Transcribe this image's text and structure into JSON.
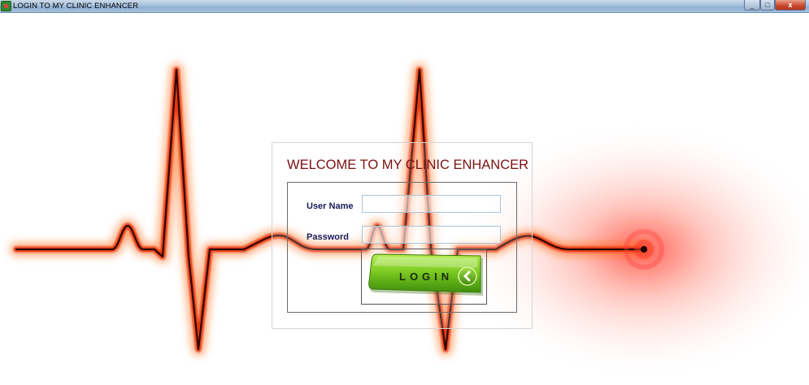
{
  "window": {
    "title": "LOGIN TO MY CLINIC ENHANCER",
    "controls": {
      "minimize": "_",
      "maximize": "□",
      "close": "x"
    }
  },
  "login": {
    "heading": "WELCOME TO MY CLINIC ENHANCER",
    "username_label": "User Name",
    "username_value": "",
    "password_label": "Password",
    "password_value": "",
    "login_button": "LOGIN"
  },
  "colors": {
    "heading": "#7a1010",
    "label": "#1b1a5a",
    "ecg_line": "#e8370a",
    "button_green": "#5fb51c"
  },
  "icons": [
    "app-icon",
    "chevron-left-icon"
  ]
}
